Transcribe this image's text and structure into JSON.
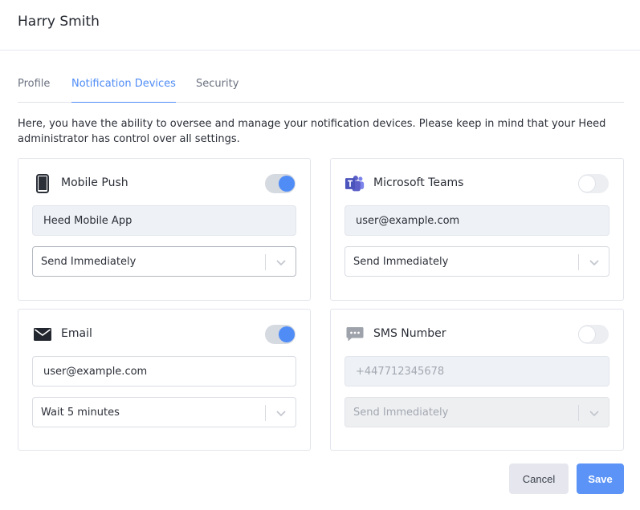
{
  "header": {
    "title": "Harry Smith"
  },
  "tabs": [
    {
      "label": "Profile",
      "active": false
    },
    {
      "label": "Notification Devices",
      "active": true
    },
    {
      "label": "Security",
      "active": false
    }
  ],
  "intro_text": "Here, you have the ability to oversee and manage your notification devices. Please keep in mind that your Heed administrator has control over all settings.",
  "devices": {
    "mobile_push": {
      "label": "Mobile Push",
      "icon": "phone-icon",
      "enabled": true,
      "value": "Heed Mobile App",
      "delivery": "Send Immediately"
    },
    "microsoft_teams": {
      "label": "Microsoft Teams",
      "icon": "teams-icon",
      "enabled": false,
      "value": "user@example.com",
      "delivery": "Send Immediately"
    },
    "email": {
      "label": "Email",
      "icon": "envelope-icon",
      "enabled": true,
      "value": "user@example.com",
      "delivery": "Wait 5 minutes"
    },
    "sms": {
      "label": "SMS Number",
      "icon": "chat-bubble-icon",
      "enabled": false,
      "placeholder": "+447712345678",
      "delivery": "Send Immediately"
    }
  },
  "actions": {
    "cancel_label": "Cancel",
    "save_label": "Save"
  },
  "colors": {
    "accent": "#4f8cf6",
    "save_button": "#5b93f7",
    "teams_brand": "#5b5fc7"
  }
}
